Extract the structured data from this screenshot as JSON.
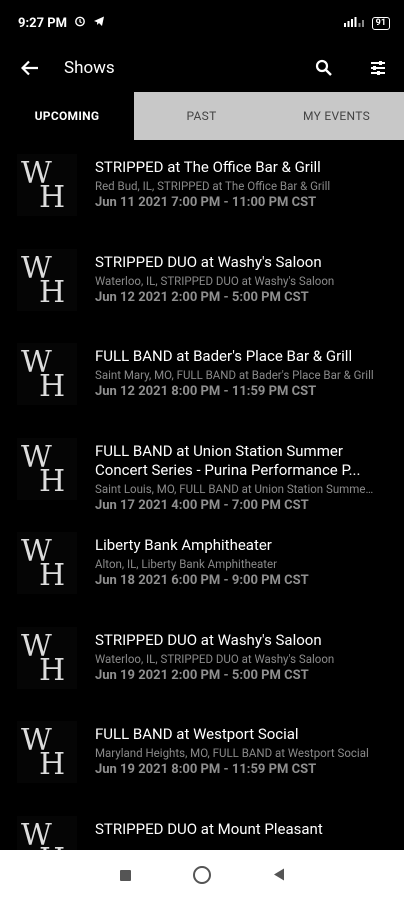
{
  "status": {
    "time": "9:27 PM",
    "battery": "91"
  },
  "appbar": {
    "title": "Shows"
  },
  "tabs": [
    {
      "label": "UPCOMING"
    },
    {
      "label": "PAST"
    },
    {
      "label": "MY EVENTS"
    }
  ],
  "shows": [
    {
      "title": "STRIPPED at The Office Bar & Grill",
      "sub": "Red Bud, IL, STRIPPED at The Office Bar & Grill",
      "date": "Jun 11 2021 7:00 PM - 11:00 PM CST"
    },
    {
      "title": "STRIPPED DUO at Washy's Saloon",
      "sub": "Waterloo, IL, STRIPPED DUO at Washy's Saloon",
      "date": "Jun 12 2021 2:00 PM - 5:00 PM CST"
    },
    {
      "title": "FULL BAND at Bader's Place Bar & Grill",
      "sub": "Saint Mary, MO, FULL BAND at Bader's Place Bar & Grill",
      "date": "Jun 12 2021 8:00 PM - 11:59 PM CST"
    },
    {
      "title": "FULL BAND at Union Station Summer Concert Series - Purina Performance P...",
      "sub": "Saint Louis, MO, FULL BAND at Union Station Summer Concert Series",
      "date": "Jun 17 2021 4:00 PM - 7:00 PM CST"
    },
    {
      "title": "Liberty Bank Amphitheater",
      "sub": "Alton, IL, Liberty Bank Amphitheater",
      "date": "Jun 18 2021 6:00 PM - 9:00 PM CST"
    },
    {
      "title": "STRIPPED DUO at Washy's Saloon",
      "sub": "Waterloo, IL, STRIPPED DUO at Washy's Saloon",
      "date": "Jun 19 2021 2:00 PM - 5:00 PM CST"
    },
    {
      "title": "FULL BAND at Westport Social",
      "sub": "Maryland Heights, MO, FULL BAND at Westport Social",
      "date": "Jun 19 2021 8:00 PM - 11:59 PM CST"
    },
    {
      "title": "STRIPPED DUO at Mount Pleasant",
      "sub": "",
      "date": ""
    }
  ],
  "thumb": {
    "line1": "W",
    "line2": "H"
  }
}
